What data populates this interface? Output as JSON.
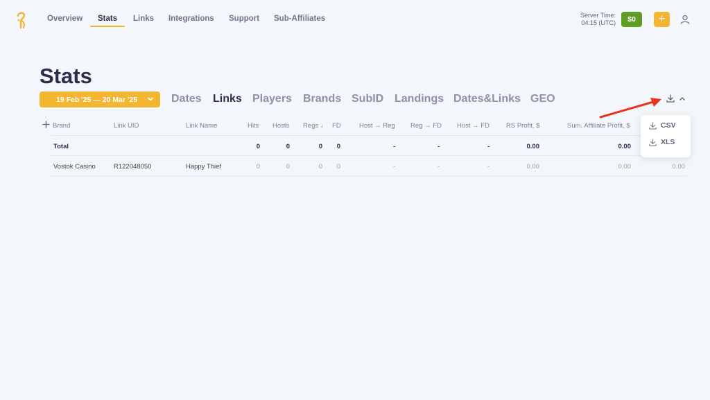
{
  "nav": {
    "items": [
      "Overview",
      "Stats",
      "Links",
      "Integrations",
      "Support",
      "Sub-Affiliates"
    ],
    "active": "Stats"
  },
  "header": {
    "server_time_label": "Server Time:",
    "server_time_value": "04:15 (UTC)",
    "balance": "$0",
    "add_label": "+"
  },
  "page": {
    "title": "Stats",
    "date_range": "19 Feb '25 — 20 Mar '25",
    "group_tabs": [
      "Dates",
      "Links",
      "Players",
      "Brands",
      "SubID",
      "Landings",
      "Dates&Links",
      "GEO"
    ],
    "active_tab": "Links"
  },
  "table": {
    "columns": [
      "Brand",
      "Link UID",
      "Link Name",
      "Hits",
      "Hosts",
      "Regs ↓",
      "FD",
      "Host → Reg",
      "Reg → FD",
      "Host → FD",
      "RS Profit, $",
      "Sum. Affiliate Profit, $"
    ],
    "total": {
      "label": "Total",
      "hits": "0",
      "hosts": "0",
      "regs": "0",
      "fd": "0",
      "host_reg": "-",
      "reg_fd": "-",
      "host_fd": "-",
      "rs_profit": "0.00",
      "sum_aff_profit": "0.00"
    },
    "rows": [
      {
        "brand": "Vostok Casino",
        "link_uid": "R122048050",
        "link_name": "Happy Thief",
        "hits": "0",
        "hosts": "0",
        "regs": "0",
        "fd": "0",
        "host_reg": "-",
        "reg_fd": "-",
        "host_fd": "-",
        "rs_profit": "0.00",
        "sum_aff_profit": "0.00",
        "extra": "0.00"
      }
    ]
  },
  "export_menu": {
    "items": [
      "CSV",
      "XLS"
    ]
  },
  "colors": {
    "accent": "#f2b632",
    "balance_green": "#5f9d24",
    "annotation_arrow": "#e8331e"
  },
  "icons": {
    "logo": "brand-logo-icon",
    "user": "user-icon",
    "download": "download-icon",
    "collapse": "chevron-up-icon",
    "add_column": "plus-icon"
  }
}
